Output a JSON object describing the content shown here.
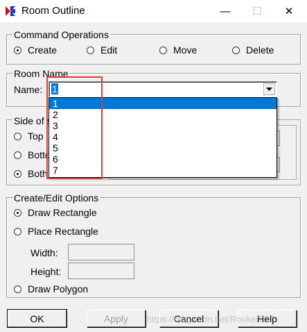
{
  "window": {
    "title": "Room Outline",
    "minimize_glyph": "—",
    "maximize_glyph": "☐",
    "close_glyph": "✕"
  },
  "command_operations": {
    "legend": "Command Operations",
    "options": [
      {
        "label": "Create",
        "checked": true
      },
      {
        "label": "Edit",
        "checked": false
      },
      {
        "label": "Move",
        "checked": false
      },
      {
        "label": "Delete",
        "checked": false
      }
    ]
  },
  "room_name": {
    "legend": "Room Name",
    "name_label": "Name:",
    "name_value": "1",
    "dropdown_options": [
      "1",
      "2",
      "3",
      "4",
      "5",
      "6",
      "7"
    ],
    "selected_index": 0
  },
  "side_of": {
    "legend": "Side of s",
    "options": [
      {
        "label": "Top",
        "checked": false
      },
      {
        "label": "Botto",
        "checked": false
      },
      {
        "label": "Both",
        "checked": true
      }
    ]
  },
  "create_edit_options": {
    "legend": "Create/Edit Options",
    "options": [
      {
        "label": "Draw Rectangle",
        "checked": true
      },
      {
        "label": "Place Rectangle",
        "checked": false
      }
    ],
    "width_label": "Width:",
    "height_label": "Height:",
    "width_value": "",
    "height_value": "",
    "polygon_option": {
      "label": "Draw Polygon",
      "checked": false
    }
  },
  "buttons": {
    "ok": "OK",
    "apply": "Apply",
    "cancel": "Cancel",
    "help": "Help"
  },
  "watermark": "https://blog.csdn.net/Rooker717"
}
